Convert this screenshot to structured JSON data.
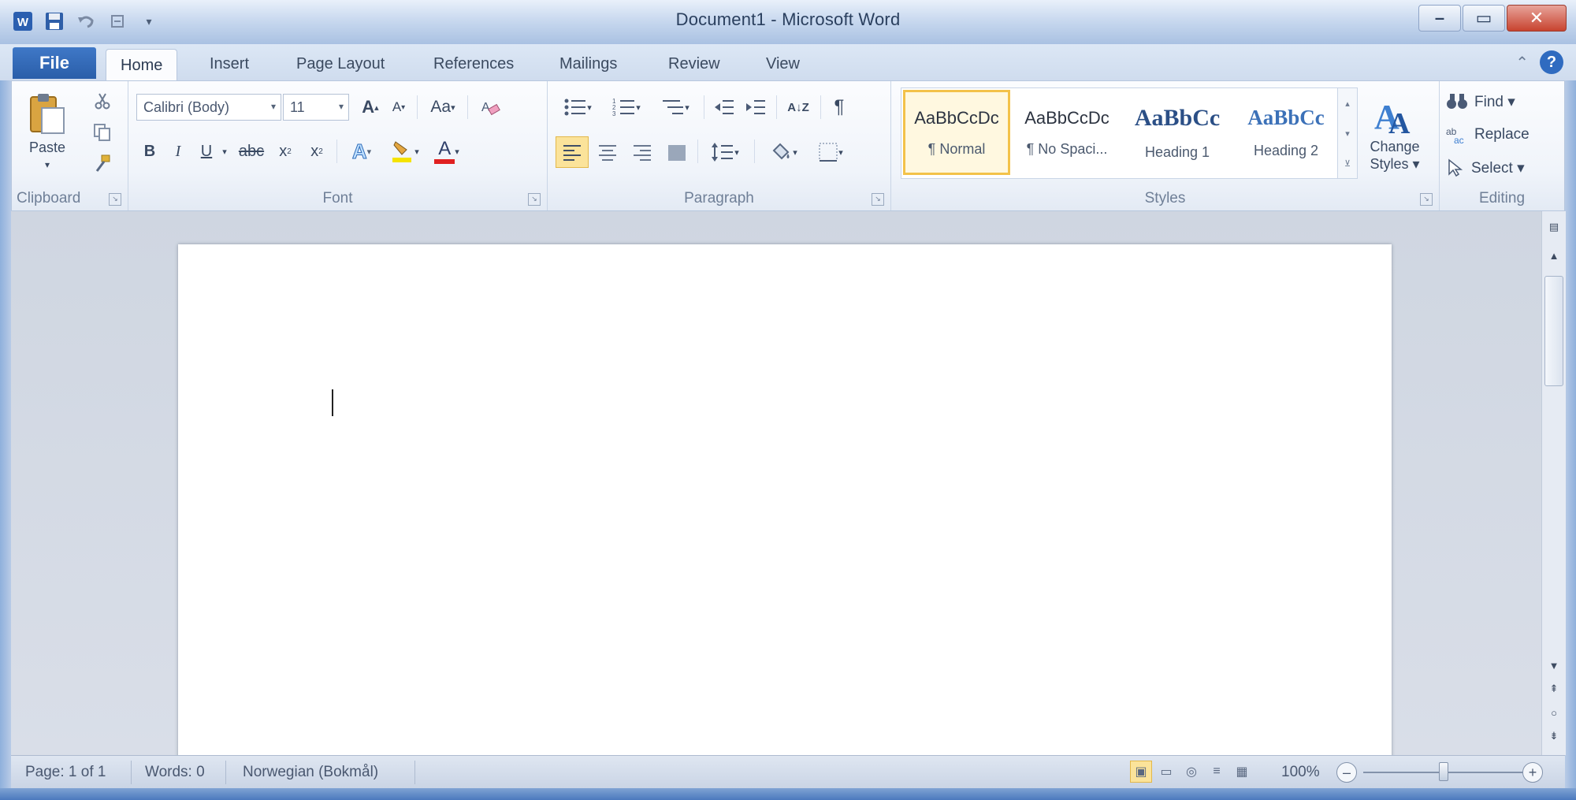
{
  "window": {
    "title": "Document1 - Microsoft Word",
    "controls": {
      "minimize": "–",
      "maximize": "▭",
      "close": "✕"
    }
  },
  "quick_access": {
    "app_icon": "word-icon",
    "save_icon": "save-icon",
    "undo_icon": "undo-icon",
    "redo_icon": "redo-icon",
    "customize_icon": "chevron-down-icon"
  },
  "tabs": {
    "file": "File",
    "items": [
      "Home",
      "Insert",
      "Page Layout",
      "References",
      "Mailings",
      "Review",
      "View"
    ],
    "active": "Home",
    "help_label": "?"
  },
  "ribbon": {
    "clipboard": {
      "label": "Clipboard",
      "paste_label": "Paste",
      "paste_arrow": "▾"
    },
    "font": {
      "label": "Font",
      "font_name": "Calibri (Body)",
      "font_size": "11",
      "grow_font": "A",
      "shrink_font": "A",
      "change_case": "Aa",
      "bold": "B",
      "italic": "I",
      "underline": "U",
      "strikethrough": "abc",
      "subscript": "x",
      "superscript": "x",
      "text_effects": "A",
      "font_color": "A"
    },
    "paragraph": {
      "label": "Paragraph",
      "sort": "A↓Z",
      "show_marks": "¶"
    },
    "styles": {
      "label": "Styles",
      "items": [
        {
          "sample": "AaBbCcDc",
          "name": "¶ Normal",
          "selected": true
        },
        {
          "sample": "AaBbCcDc",
          "name": "¶ No Spaci...",
          "selected": false
        },
        {
          "sample": "AaBbCc",
          "name": "Heading 1",
          "selected": false
        },
        {
          "sample": "AaBbCc",
          "name": "Heading 2",
          "selected": false
        }
      ],
      "change_styles_line1": "Change",
      "change_styles_line2": "Styles ▾"
    },
    "editing": {
      "label": "Editing",
      "find": "Find ▾",
      "replace": "Replace",
      "select": "Select ▾"
    }
  },
  "status": {
    "page": "Page: 1 of 1",
    "words": "Words: 0",
    "language": "Norwegian (Bokmål)",
    "zoom": "100%",
    "zoom_out": "–",
    "zoom_in": "+"
  },
  "colors": {
    "accent": "#2a5ea9",
    "selected_style": "#f3c24a",
    "highlight": "#f5e300",
    "font_color_bar": "#e02020"
  }
}
